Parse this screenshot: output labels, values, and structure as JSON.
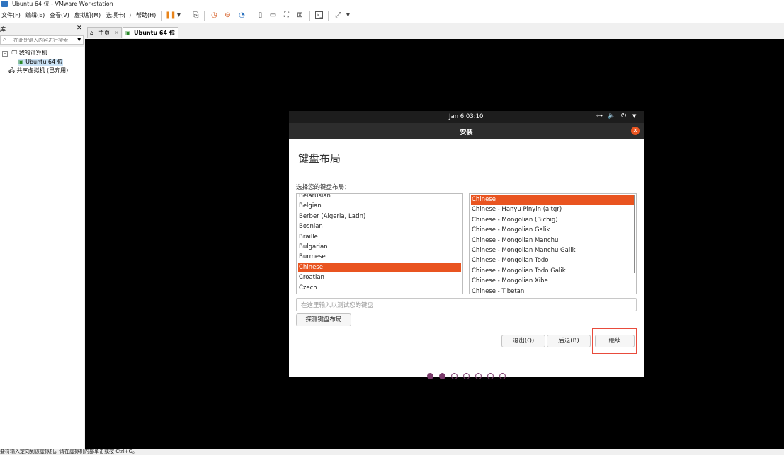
{
  "window": {
    "title": "Ubuntu 64 位 - VMware Workstation"
  },
  "menu": [
    "文件(F)",
    "编辑(E)",
    "查看(V)",
    "虚拟机(M)",
    "选项卡(T)",
    "帮助(H)"
  ],
  "library": {
    "title": "库",
    "search_placeholder": "在此处键入内容进行搜索",
    "tree": {
      "my_computer": "我的计算机",
      "vm": "Ubuntu 64 位",
      "shared": "共享虚拟机 (已弃用)"
    }
  },
  "tabs": [
    {
      "label": "主页"
    },
    {
      "label": "Ubuntu 64 位"
    }
  ],
  "ubuntu": {
    "clock": "Jan 6  03:10",
    "window_title": "安装",
    "page_title": "键盘布局",
    "prompt": "选择您的键盘布局：",
    "layouts": [
      "Belarusian",
      "Belgian",
      "Berber (Algeria, Latin)",
      "Bosnian",
      "Braille",
      "Bulgarian",
      "Burmese",
      "Chinese",
      "Croatian",
      "Czech"
    ],
    "selected_layout": "Chinese",
    "variants": [
      "Chinese",
      "Chinese - Hanyu Pinyin (altgr)",
      "Chinese - Mongolian (Bichig)",
      "Chinese - Mongolian Galik",
      "Chinese - Mongolian Manchu",
      "Chinese - Mongolian Manchu Galik",
      "Chinese - Mongolian Todo",
      "Chinese - Mongolian Todo Galik",
      "Chinese - Mongolian Xibe",
      "Chinese - Tibetan"
    ],
    "selected_variant": "Chinese",
    "test_placeholder": "在这里输入以测试您的键盘",
    "detect_button": "探测键盘布局",
    "quit_button": "退出(Q)",
    "back_button": "后退(B)",
    "continue_button": "继续",
    "progress": {
      "current": 2,
      "total": 7
    }
  },
  "highlight_color": "#e84b3c",
  "accent_color": "#e95420",
  "status_text": "要将输入定向到该虚拟机，请在虚拟机内部单击或按 Ctrl+G。"
}
